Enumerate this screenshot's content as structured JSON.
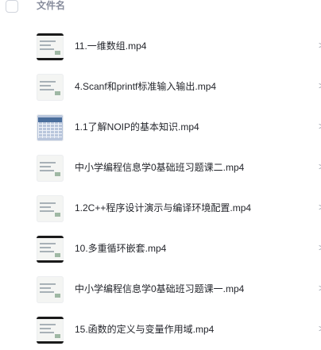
{
  "header": {
    "column_label": "文件名"
  },
  "files": [
    {
      "name": "11.一维数组.mp4",
      "thumbnail_icon": "video-thumbnail-icon"
    },
    {
      "name": "4.Scanf和printf标准输入输出.mp4",
      "thumbnail_icon": "video-thumbnail-icon"
    },
    {
      "name": "1.1了解NOIP的基本知识.mp4",
      "thumbnail_icon": "video-thumbnail-icon"
    },
    {
      "name": "中小学编程信息学0基础班习题课二.mp4",
      "thumbnail_icon": "video-thumbnail-icon"
    },
    {
      "name": "1.2C++程序设计演示与编译环境配置.mp4",
      "thumbnail_icon": "video-thumbnail-icon"
    },
    {
      "name": "10.多重循环嵌套.mp4",
      "thumbnail_icon": "video-thumbnail-icon"
    },
    {
      "name": "中小学编程信息学0基础班习题课一.mp4",
      "thumbnail_icon": "video-thumbnail-icon"
    },
    {
      "name": "15.函数的定义与变量作用域.mp4",
      "thumbnail_icon": "video-thumbnail-icon"
    }
  ],
  "colors": {
    "header_text": "#878c9c",
    "file_text": "#24262c",
    "border": "#d0d4dc"
  }
}
